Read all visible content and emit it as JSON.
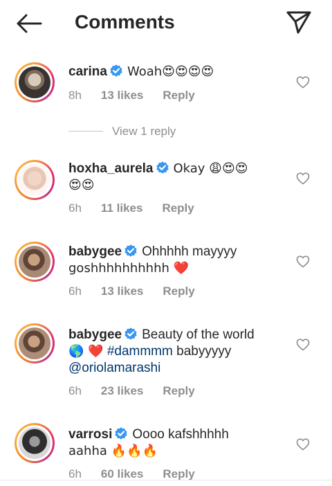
{
  "header": {
    "title": "Comments"
  },
  "view_reply": "View 1 reply",
  "comments": [
    {
      "username": "carina",
      "text": "Woah😍😍😍😍",
      "time": "8h",
      "likes": "13 likes",
      "reply": "Reply"
    },
    {
      "username": "hoxha_aurela",
      "text_line1": "Okay 😩😍😍",
      "text_line2": "😍😍",
      "time": "6h",
      "likes": "11 likes",
      "reply": "Reply"
    },
    {
      "username": "babygee",
      "text_line1": "Ohhhhh mayyyy",
      "text_line2": "goshhhhhhhhhh ❤️",
      "time": "6h",
      "likes": "13 likes",
      "reply": "Reply"
    },
    {
      "username": "babygee",
      "text_line1": "Beauty of the world",
      "emoji_prefix": "🌎 ❤️",
      "hashtag": "#dammmm",
      "text_rest": "babyyyyy",
      "mention": "@oriolamarashi",
      "time": "6h",
      "likes": "23 likes",
      "reply": "Reply"
    },
    {
      "username": "varrosi",
      "text_line1": "Oooo kafshhhhh",
      "text_line2": "aahha 🔥🔥🔥",
      "time": "6h",
      "likes": "60 likes",
      "reply": "Reply"
    }
  ],
  "icons": {
    "back": "arrow-left-icon",
    "send": "paper-plane-icon",
    "verified": "verified-badge-icon",
    "heart": "heart-outline-icon"
  },
  "colors": {
    "verified": "#3897f0",
    "link": "#00376b",
    "meta": "#8e8e8e",
    "text": "#262626"
  }
}
